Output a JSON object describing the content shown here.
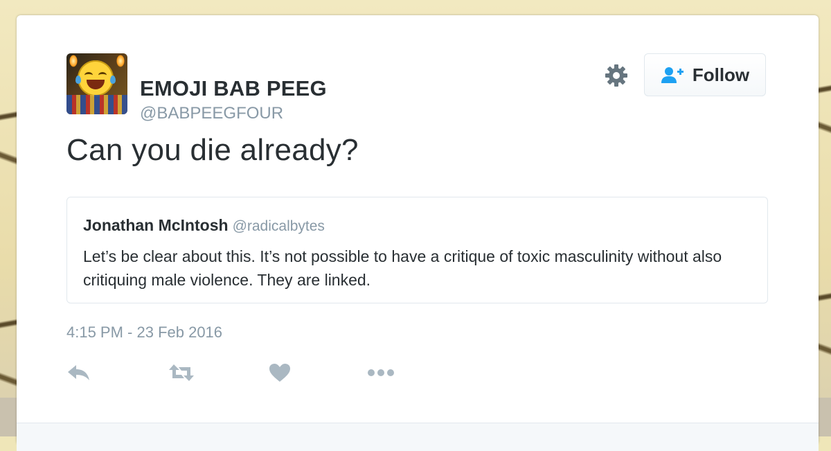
{
  "author": {
    "display_name": "EMOJI BAB PEEG",
    "handle": "@BABPEEGFOUR",
    "avatar_icon": "crying-laughing-emoji-avatar"
  },
  "header": {
    "settings_icon": "gear-icon",
    "follow_label": "Follow",
    "follow_icon": "add-user-icon"
  },
  "tweet": {
    "text": "Can you die already?",
    "timestamp": "4:15 PM - 23 Feb 2016"
  },
  "quoted_tweet": {
    "name": "Jonathan McIntosh",
    "handle": "@radicalbytes",
    "text": "Let’s be clear about this. It’s not possible to have a critique of toxic masculinity without also critiquing male violence. They are linked."
  },
  "actions": [
    {
      "name": "reply",
      "icon": "reply-icon"
    },
    {
      "name": "retweet",
      "icon": "retweet-icon"
    },
    {
      "name": "like",
      "icon": "heart-icon"
    },
    {
      "name": "more",
      "icon": "more-dots-icon"
    }
  ],
  "colors": {
    "text_primary": "#292f33",
    "text_secondary": "#8899a6",
    "follow_icon": "#1da1f2",
    "border": "#e1e8ed"
  }
}
